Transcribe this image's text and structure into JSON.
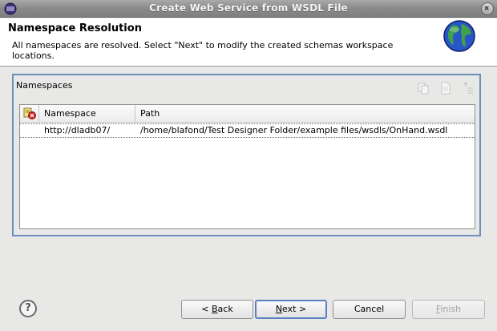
{
  "window": {
    "title": "Create Web Service from WSDL File"
  },
  "header": {
    "title": "Namespace Resolution",
    "description": "All namespaces are resolved. Select \"Next\" to modify the created schemas workspace locations."
  },
  "group": {
    "label": "Namespaces",
    "toolbar_icons": [
      "copy-icon",
      "paste-icon",
      "sort-icon"
    ]
  },
  "table": {
    "columns": [
      "Namespace",
      "Path"
    ],
    "rows": [
      {
        "namespace": "http://dladb07/",
        "path": "/home/blafond/Test Designer Folder/example files/wsdls/OnHand.wsdl"
      }
    ]
  },
  "footer": {
    "help_icon": "?",
    "back": {
      "mnemonic": "B",
      "rest": "ack",
      "prefix": "< "
    },
    "next": {
      "mnemonic": "N",
      "rest": "ext",
      "suffix": " >"
    },
    "cancel": "Cancel",
    "finish": {
      "mnemonic": "F",
      "rest": "inish"
    }
  }
}
